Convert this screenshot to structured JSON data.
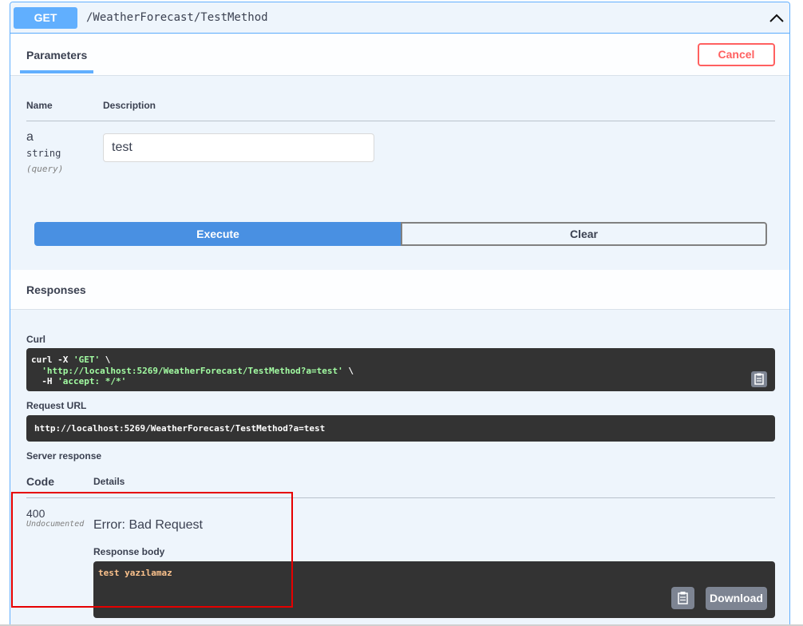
{
  "operation": {
    "method": "GET",
    "path": "/WeatherForecast/TestMethod"
  },
  "parameters_section": {
    "tab_label": "Parameters",
    "cancel_label": "Cancel",
    "columns": {
      "name": "Name",
      "description": "Description"
    },
    "param": {
      "name": "a",
      "type": "string",
      "in": "(query)",
      "value": "test"
    },
    "execute_label": "Execute",
    "clear_label": "Clear"
  },
  "responses_section": {
    "title": "Responses",
    "curl_label": "Curl",
    "curl_lines": [
      "curl -X 'GET' \\",
      "  'http://localhost:5269/WeatherForecast/TestMethod?a=test' \\",
      "  -H 'accept: */*'"
    ],
    "request_url_label": "Request URL",
    "request_url": "http://localhost:5269/WeatherForecast/TestMethod?a=test",
    "server_response_label": "Server response",
    "columns": {
      "code": "Code",
      "details": "Details"
    },
    "response": {
      "code": "400",
      "documented": "Undocumented",
      "title": "Error: Bad Request",
      "body_label": "Response body",
      "body": "test yazılamaz",
      "download_label": "Download"
    }
  },
  "colors": {
    "get_accent": "#61affe",
    "execute_blue": "#4990e2",
    "cancel_red": "#ff6060",
    "highlight_red": "#e60000",
    "code_bg": "#333333"
  },
  "icons": {
    "collapse": "chevron-up-icon",
    "copy": "clipboard-icon"
  }
}
